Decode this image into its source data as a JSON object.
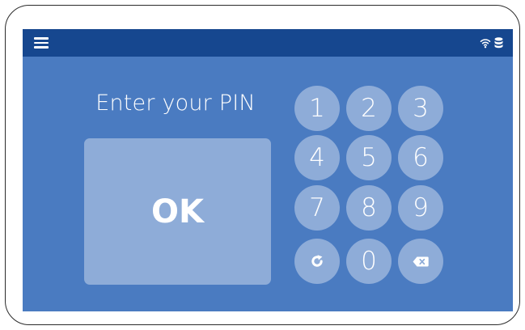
{
  "header": {
    "menu_icon": "hamburger-menu-icon",
    "status_icons": [
      "wifi-icon",
      "database-icon"
    ]
  },
  "login": {
    "prompt": "Enter your PIN",
    "ok_label": "OK"
  },
  "keypad": {
    "keys": [
      {
        "label": "1"
      },
      {
        "label": "2"
      },
      {
        "label": "3"
      },
      {
        "label": "4"
      },
      {
        "label": "5"
      },
      {
        "label": "6"
      },
      {
        "label": "7"
      },
      {
        "label": "8"
      },
      {
        "label": "9"
      },
      {
        "label": "",
        "icon": "refresh-icon"
      },
      {
        "label": "0"
      },
      {
        "label": "",
        "icon": "backspace-icon"
      }
    ]
  },
  "colors": {
    "screen_background": "#4a7bc1",
    "top_bar": "#16478f",
    "button_fill": "#8eacd8",
    "text": "#ffffff"
  }
}
